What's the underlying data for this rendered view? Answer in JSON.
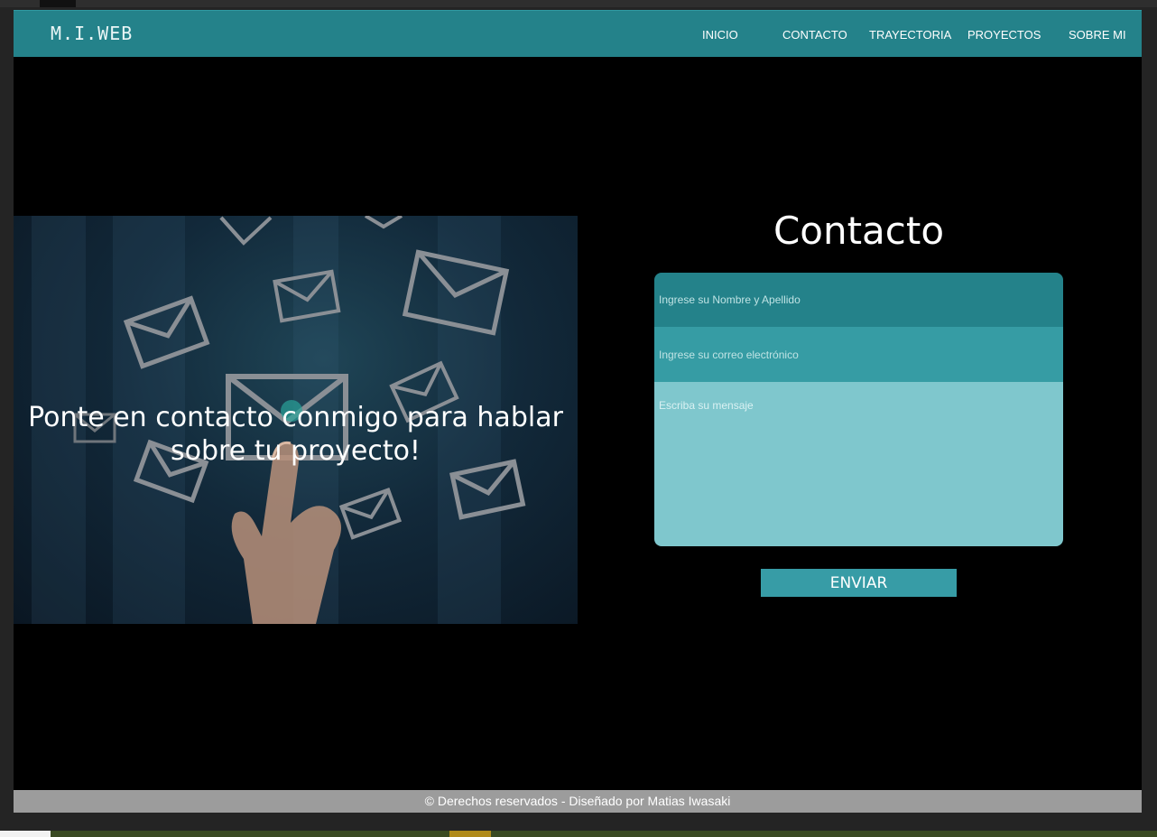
{
  "site": {
    "logo": "M.I.WEB"
  },
  "nav": {
    "items": [
      {
        "label": "INICIO"
      },
      {
        "label": "CONTACTO"
      },
      {
        "label": "TRAYECTORIA"
      },
      {
        "label": "PROYECTOS"
      },
      {
        "label": "SOBRE MI"
      }
    ]
  },
  "hero": {
    "line1": "Ponte en contacto conmigo para hablar",
    "line2": "sobre tu proyecto!"
  },
  "contact": {
    "title": "Contacto",
    "name_placeholder": "Ingrese su Nombre y Apellido",
    "email_placeholder": "Ingrese su correo electrónico",
    "message_placeholder": "Escriba su mensaje",
    "submit_label": "ENVIAR"
  },
  "footer": {
    "text": "© Derechos reservados - Diseñado por Matias Iwasaki"
  },
  "colors": {
    "primary": "#24828a",
    "secondary": "#369ca4",
    "light": "#7fc7cd",
    "footer": "#9c9c9c",
    "background": "#000000"
  }
}
